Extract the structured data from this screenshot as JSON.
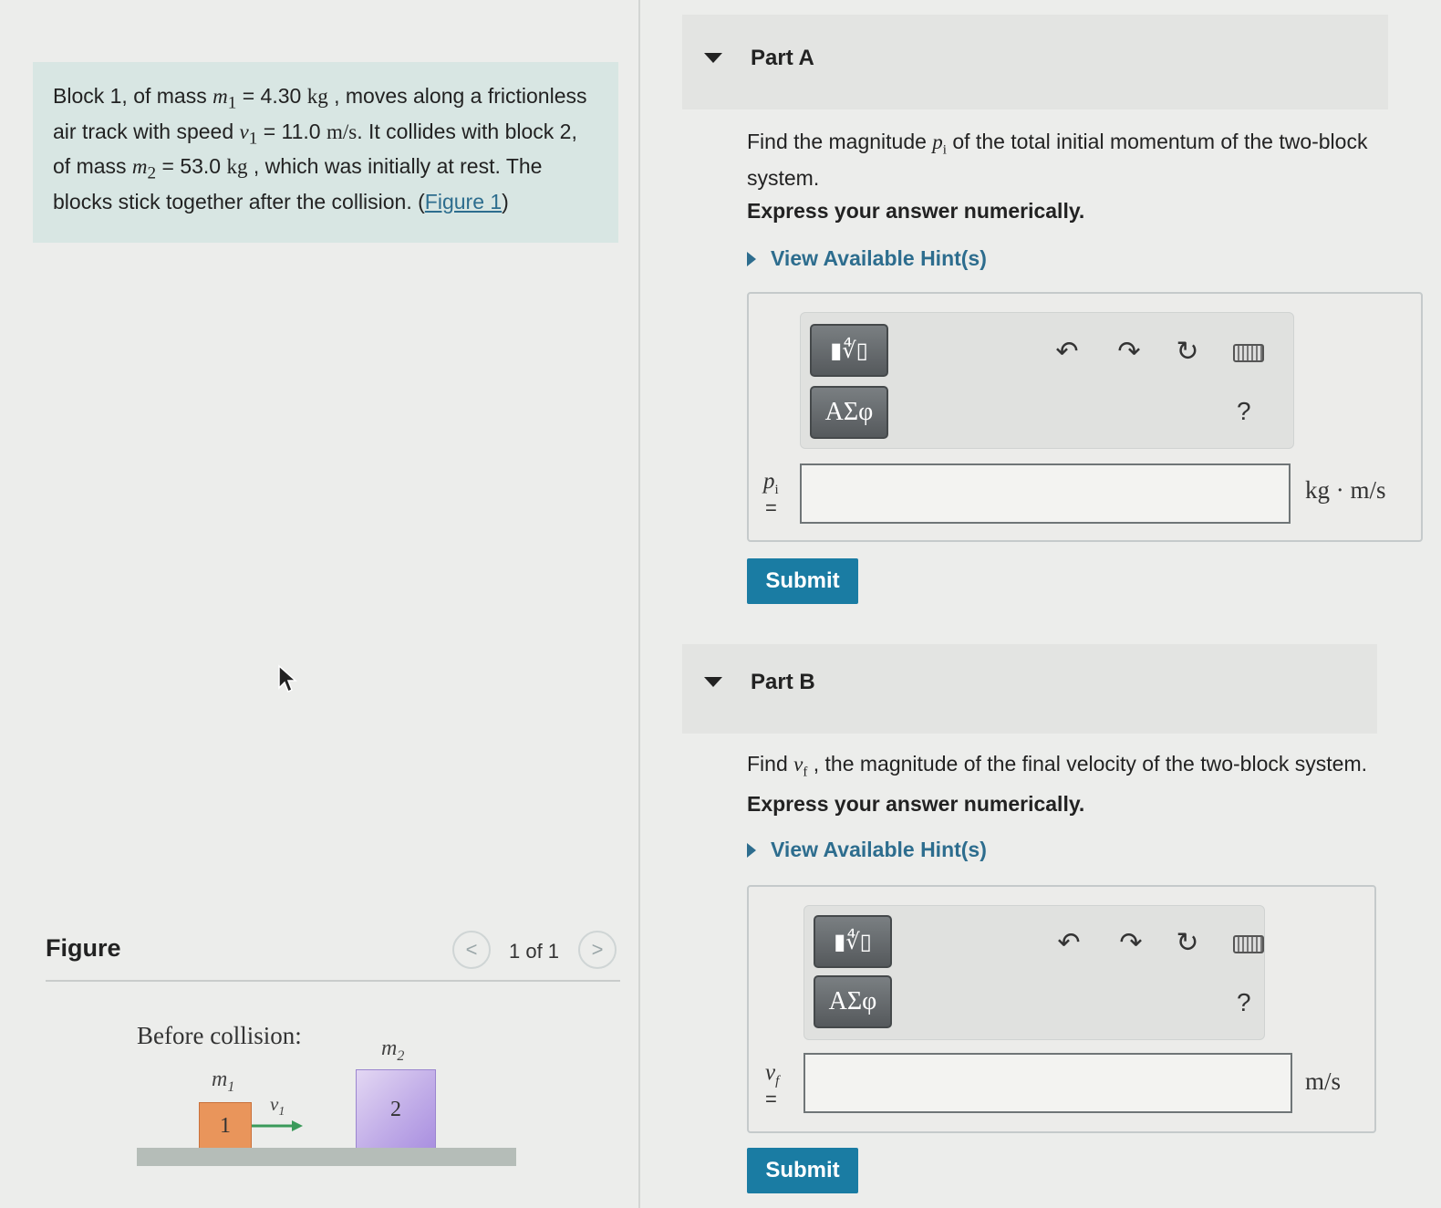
{
  "problem": {
    "text_1": "Block 1, of mass ",
    "m1_sym": "m",
    "m1_sub": "1",
    "eq_1": " = 4.30 ",
    "unit_kg_1": "kg",
    "text_2": " , moves along a frictionless air track with speed ",
    "v1_sym": "v",
    "v1_sub": "1",
    "eq_2": " = 11.0 ",
    "unit_ms": "m/s",
    "text_3": ". It collides with block 2, of mass ",
    "m2_sym": "m",
    "m2_sub": "2",
    "eq_3": " = 53.0 ",
    "unit_kg_2": "kg",
    "text_4": " , which was initially at rest. The blocks stick together after the collision. (",
    "figure_link": "Figure 1",
    "text_5": ")"
  },
  "figure": {
    "title": "Figure",
    "pager": "1 of 1",
    "prev_symbol": "<",
    "next_symbol": ">",
    "before_label": "Before collision:",
    "m1_label": "m",
    "m1_label_sub": "1",
    "m2_label": "m",
    "m2_label_sub": "2",
    "v1_label": "v",
    "v1_label_sub": "1",
    "block1_number": "1",
    "block2_number": "2"
  },
  "partA": {
    "title": "Part A",
    "q_pre": "Find the magnitude ",
    "q_var": "p",
    "q_var_sub": "i",
    "q_post": " of the total initial momentum of the two-block system.",
    "express": "Express your answer numerically.",
    "hint": "View Available Hint(s)",
    "var_label": "p",
    "var_label_sub": "i",
    "eq": "=",
    "unit": "kg · m/s",
    "input_value": "",
    "submit": "Submit",
    "btn_templates": "▮∜▯",
    "btn_greek": "ΑΣφ",
    "help": "?"
  },
  "partB": {
    "title": "Part B",
    "q_pre": "Find ",
    "q_var": "v",
    "q_var_sub": "f",
    "q_post": " , the magnitude of the final velocity of the two-block system.",
    "express": "Express your answer numerically.",
    "hint": "View Available Hint(s)",
    "var_label": "v",
    "var_label_sub": "f",
    "eq": "=",
    "unit": "m/s",
    "input_value": "",
    "submit": "Submit",
    "btn_templates": "▮∜▯",
    "btn_greek": "ΑΣφ",
    "help": "?"
  },
  "icons": {
    "undo": "undo-icon",
    "redo": "redo-icon",
    "reset": "reset-icon",
    "keyboard": "keyboard-icon"
  },
  "colors": {
    "accent": "#1a7ca3",
    "link": "#2d6d8e",
    "problem_bg": "#d8e6e3"
  }
}
